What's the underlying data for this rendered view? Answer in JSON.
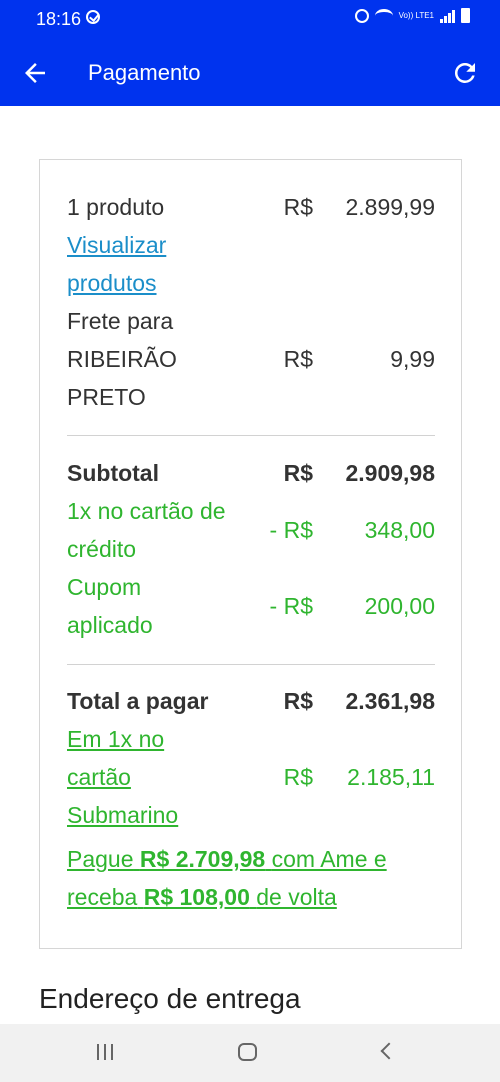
{
  "status_bar": {
    "time": "18:16",
    "volte_label": "Vo)) LTE1"
  },
  "app_bar": {
    "title": "Pagamento"
  },
  "summary": {
    "products": {
      "label": "1 produto",
      "currency": "R$",
      "amount": "2.899,99"
    },
    "view_products_line1": "Visualizar",
    "view_products_line2": "produtos",
    "shipping": {
      "line1": "Frete para",
      "line2": "RIBEIRÃO",
      "line3": "PRETO",
      "currency": "R$",
      "amount": "9,99"
    },
    "subtotal": {
      "label": "Subtotal",
      "currency": "R$",
      "amount": "2.909,98"
    },
    "card_discount": {
      "line1": "1x no cartão de",
      "line2": "crédito",
      "currency": "- R$",
      "amount": "348,00"
    },
    "coupon": {
      "line1": "Cupom",
      "line2": "aplicado",
      "currency": "- R$",
      "amount": "200,00"
    },
    "total": {
      "label": "Total a pagar",
      "currency": "R$",
      "amount": "2.361,98"
    },
    "submarino": {
      "line1": "Em 1x no",
      "line2": "cartão",
      "line3": "Submarino",
      "currency": "R$",
      "amount": "2.185,11"
    },
    "ame": {
      "pay_prefix": "Pague",
      "pay_amount": "R$ 2.709,98",
      "pay_suffix": "com Ame e",
      "receive_prefix": "receba",
      "receive_amount": "R$ 108,00",
      "receive_suffix": "de volta"
    }
  },
  "delivery_section": {
    "title": "Endereço de entrega"
  },
  "colors": {
    "brand_blue": "#0033ee",
    "discount_green": "#2fb52f",
    "link_blue": "#1b8ec9"
  }
}
